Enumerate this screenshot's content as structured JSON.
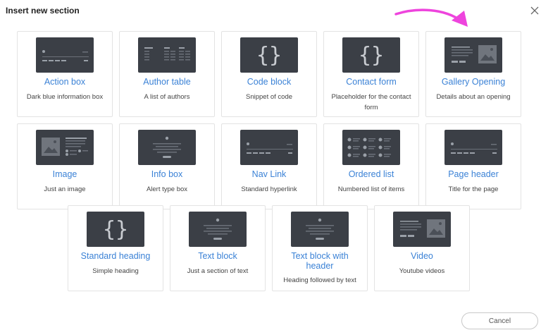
{
  "dialog": {
    "title": "Insert new section",
    "cancel_label": "Cancel"
  },
  "colors": {
    "link": "#3b82d6",
    "thumbnail": "#3b3f46",
    "arrow": "#ee44dd"
  },
  "sections": [
    {
      "name": "Action box",
      "description": "Dark blue information box",
      "thumbnail": "action-box"
    },
    {
      "name": "Author table",
      "description": "A list of authors",
      "thumbnail": "author-table"
    },
    {
      "name": "Code block",
      "description": "Snippet of code",
      "thumbnail": "curly-braces-icon"
    },
    {
      "name": "Contact form",
      "description": "Placeholder for the contact form",
      "thumbnail": "curly-braces-icon"
    },
    {
      "name": "Gallery Opening",
      "description": "Details about an opening",
      "thumbnail": "text-and-image"
    },
    {
      "name": "Image",
      "description": "Just an image",
      "thumbnail": "image-with-list"
    },
    {
      "name": "Info box",
      "description": "Alert type box",
      "thumbnail": "centered-text"
    },
    {
      "name": "Nav Link",
      "description": "Standard hyperlink",
      "thumbnail": "action-box"
    },
    {
      "name": "Ordered list",
      "description": "Numbered list of items",
      "thumbnail": "ordered-list"
    },
    {
      "name": "Page header",
      "description": "Title for the page",
      "thumbnail": "action-box"
    },
    {
      "name": "Standard heading",
      "description": "Simple heading",
      "thumbnail": "curly-braces-icon"
    },
    {
      "name": "Text block",
      "description": "Just a section of text",
      "thumbnail": "centered-text"
    },
    {
      "name": "Text block with header",
      "description": "Heading followed by text",
      "thumbnail": "centered-text"
    },
    {
      "name": "Video",
      "description": "Youtube videos",
      "thumbnail": "text-and-image"
    }
  ]
}
